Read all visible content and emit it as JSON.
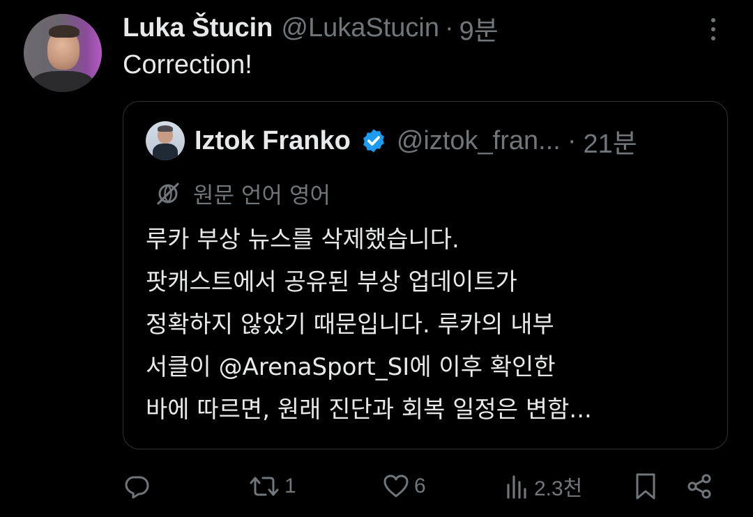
{
  "tweet": {
    "display_name": "Luka Štucin",
    "handle": "@LukaStucin",
    "separator": "·",
    "time": "9분",
    "text": "Correction!"
  },
  "quote": {
    "display_name": "Iztok Franko",
    "handle": "@iztok_fran...",
    "separator": "·",
    "time": "21분",
    "verified": true,
    "translate_label": "원문 언어 영어",
    "body_lines": [
      "루카 부상 뉴스를 삭제했습니다.",
      "팟캐스트에서 공유된 부상 업데이트가",
      "정확하지 않았기 때문입니다. 루카의 내부",
      "서클이 @ArenaSport_SI에 이후 확인한",
      "바에 따르면, 원래 진단과 회복 일정은 변함..."
    ]
  },
  "actions": {
    "reply_count": "",
    "retweet_count": "1",
    "like_count": "6",
    "views_count": "2.3천"
  },
  "colors": {
    "background": "#000000",
    "text_primary": "#e7e9ea",
    "text_secondary": "#71767b",
    "border": "#2f3336",
    "verified_blue": "#1d9bf0"
  },
  "icons": {
    "more": "more-vertical-icon",
    "verified": "verified-badge-icon",
    "translate": "globe-slash-icon",
    "reply": "reply-icon",
    "retweet": "retweet-icon",
    "like": "heart-icon",
    "views": "views-bar-chart-icon",
    "bookmark": "bookmark-icon",
    "share": "share-icon"
  }
}
